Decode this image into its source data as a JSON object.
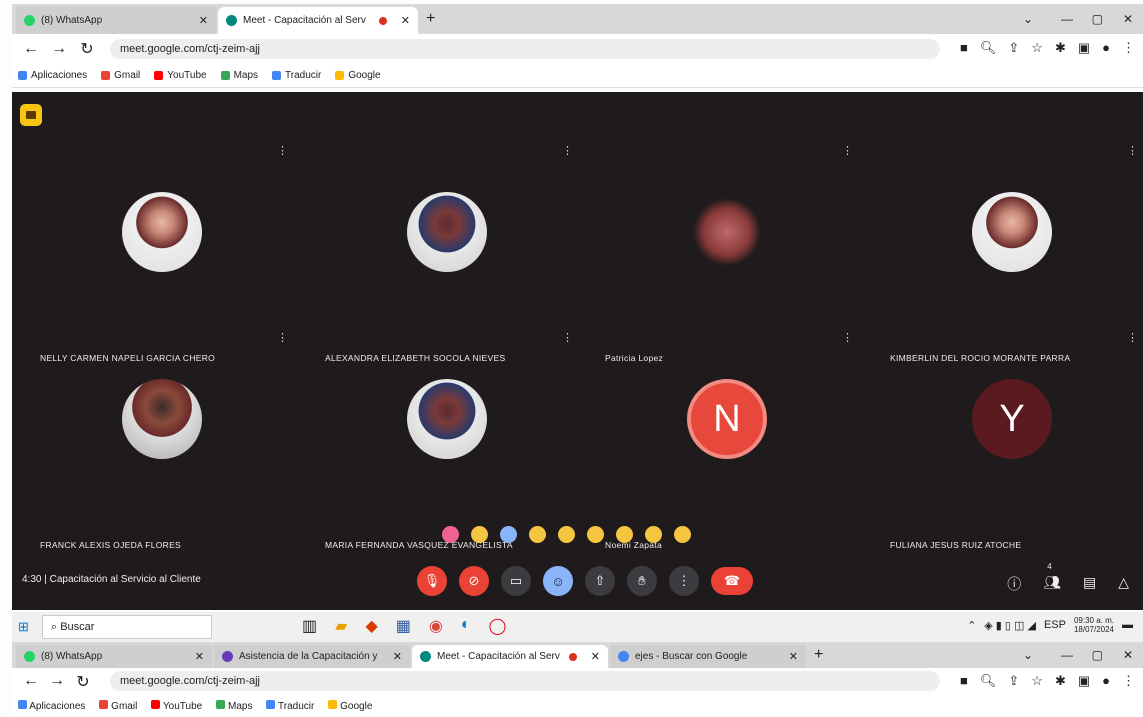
{
  "browser_top": {
    "tabs": [
      {
        "title": "(8) WhatsApp",
        "favicon_color": "#25d366",
        "active": false
      },
      {
        "title": "Meet - Capacitación al Serv",
        "favicon_color": "#00897b",
        "active": true,
        "recording": true
      }
    ],
    "url": "meet.google.com/ctj-zeim-ajj",
    "bookmarks": [
      "Aplicaciones",
      "Gmail",
      "YouTube",
      "Maps",
      "Traducir",
      "Google"
    ]
  },
  "meet": {
    "participants": [
      {
        "name": "NELLY CARMEN NAPELI GARCIA CHERO",
        "avatar": "photo"
      },
      {
        "name": "ALEXANDRA ELIZABETH SOCOLA NIEVES",
        "avatar": "photo2"
      },
      {
        "name": "Patricia Lopez",
        "avatar": "meat"
      },
      {
        "name": "KIMBERLIN DEL ROCIO MORANTE PARRA",
        "avatar": "photo"
      },
      {
        "name": "FRANCK ALEXIS OJEDA FLORES",
        "avatar": "photo3"
      },
      {
        "name": "MARIA FERNANDA VASQUEZ EVANGELISTA",
        "avatar": "photo2"
      },
      {
        "name": "Noemi Zapata",
        "avatar": "letter",
        "letter": "N",
        "color": "#e8473b"
      },
      {
        "name": "FULIANA JESUS RUIZ ATOCHE",
        "avatar": "letter",
        "letter": "Y",
        "color": "#5a1a20"
      }
    ],
    "reactions": [
      "heart",
      "thumbs-up",
      "party",
      "clap",
      "laugh",
      "surprised",
      "sad",
      "thinking",
      "thumbs-down"
    ],
    "reaction_colors": [
      "#f06292",
      "#f5c542",
      "#8ab4f8",
      "#f5c542",
      "#f5c542",
      "#f5c542",
      "#f5c542",
      "#f5c542",
      "#f5c542"
    ],
    "meeting_time": "4:30",
    "meeting_title": "Capacitación al Servicio al Cliente",
    "participant_count": "4"
  },
  "taskbar": {
    "search_placeholder": "Buscar",
    "time": "09:30 a. m.",
    "date": "18/07/2024"
  },
  "browser_bottom": {
    "tabs": [
      {
        "title": "(8) WhatsApp",
        "favicon_color": "#25d366"
      },
      {
        "title": "Asistencia de la Capacitación y",
        "favicon_color": "#673ab7"
      },
      {
        "title": "Meet - Capacitación al Serv",
        "favicon_color": "#00897b"
      },
      {
        "title": "ejes - Buscar con Google",
        "favicon_color": "#4285f4"
      }
    ],
    "url": "meet.google.com/ctj-zeim-ajj",
    "bookmarks": [
      "Aplicaciones",
      "Gmail",
      "YouTube",
      "Maps",
      "Traducir",
      "Google"
    ]
  }
}
